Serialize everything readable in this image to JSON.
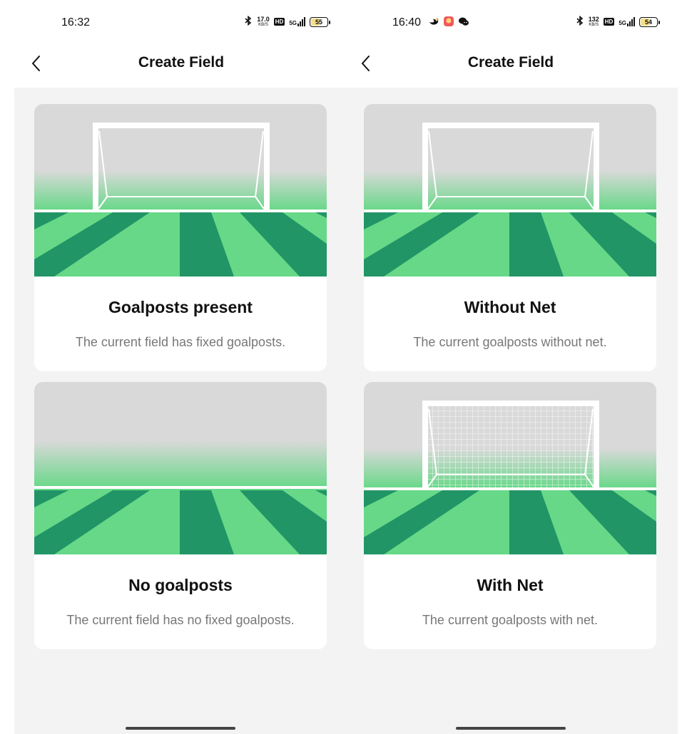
{
  "screens": [
    {
      "status": {
        "time": "16:32",
        "speed_value": "17.0",
        "speed_unit": "KB/S",
        "hd": "HD",
        "network": "5G",
        "battery": "55"
      },
      "nav": {
        "title": "Create Field"
      },
      "cards": [
        {
          "title": "Goalposts present",
          "desc": "The current field has fixed goalposts.",
          "illustration": "goal-without-net"
        },
        {
          "title": "No goalposts",
          "desc": "The current field has no fixed goalposts.",
          "illustration": "empty-field"
        }
      ]
    },
    {
      "status": {
        "time": "16:40",
        "speed_value": "132",
        "speed_unit": "KB/S",
        "hd": "HD",
        "network": "5G",
        "battery": "54",
        "app_icons": [
          "swan-icon",
          "red-app-icon",
          "wechat-icon"
        ]
      },
      "nav": {
        "title": "Create Field"
      },
      "cards": [
        {
          "title": "Without Net",
          "desc": "The current goalposts without net.",
          "illustration": "goal-without-net"
        },
        {
          "title": "With Net",
          "desc": "The current goalposts with net.",
          "illustration": "goal-with-net"
        }
      ]
    }
  ],
  "colors": {
    "field_light": "#66d887",
    "field_dark": "#219566",
    "sky": "#d9d9d9",
    "background": "#f3f3f3",
    "card": "#ffffff"
  }
}
